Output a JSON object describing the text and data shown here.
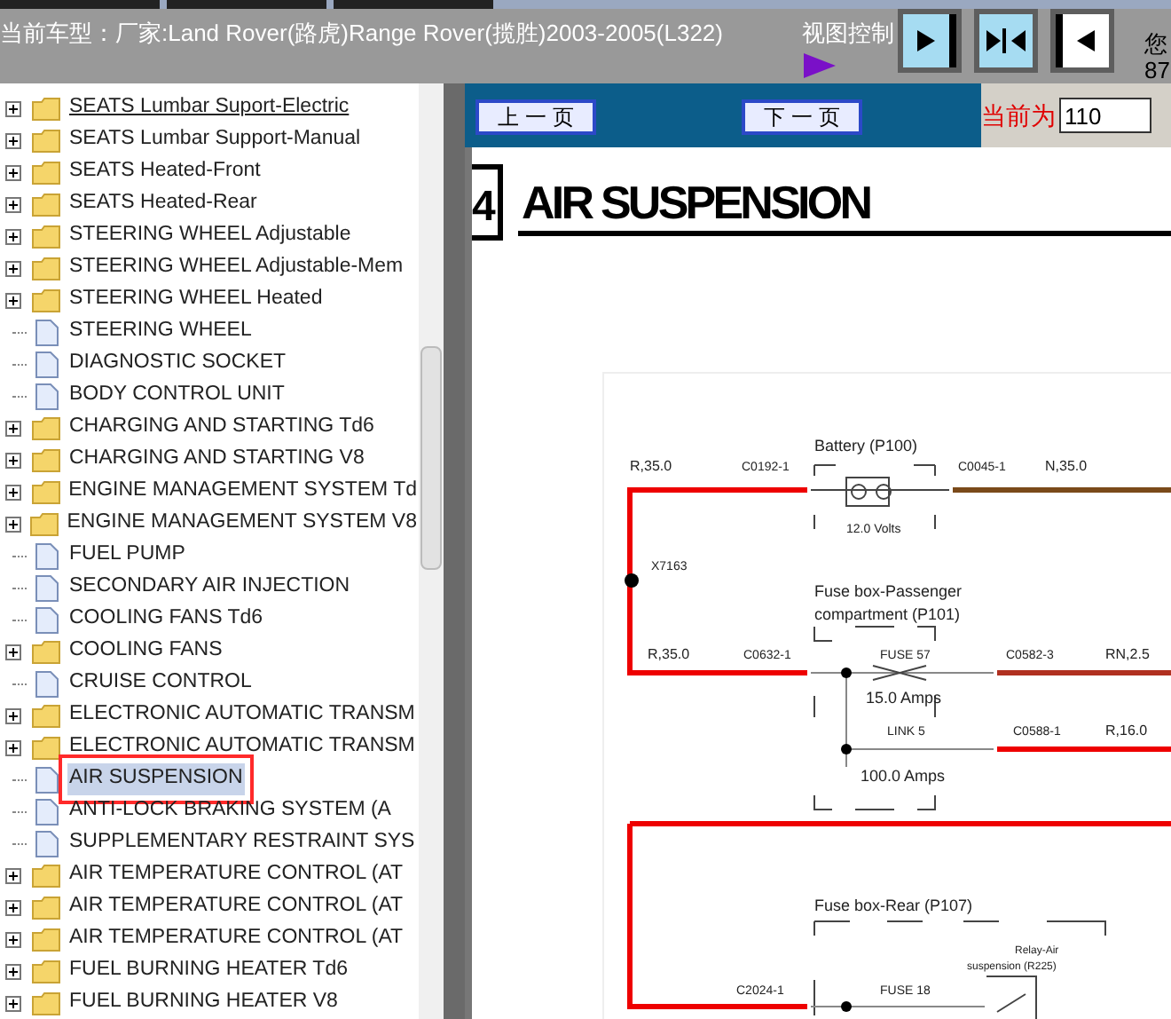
{
  "header": {
    "title": "当前车型：厂家:Land Rover(路虎)Range Rover(揽胜)2003-2005(L322)",
    "view_control_label": "视图控制",
    "edge_text_1": "您",
    "edge_text_2": "87"
  },
  "tree": {
    "items": [
      {
        "label": "SEATS Lumbar Suport-Electric",
        "kind": "folder",
        "hovered": true,
        "selected": false
      },
      {
        "label": "SEATS Lumbar Support-Manual",
        "kind": "folder",
        "hovered": false,
        "selected": false
      },
      {
        "label": "SEATS Heated-Front",
        "kind": "folder",
        "hovered": false,
        "selected": false
      },
      {
        "label": "SEATS Heated-Rear",
        "kind": "folder",
        "hovered": false,
        "selected": false
      },
      {
        "label": "STEERING WHEEL Adjustable",
        "kind": "folder",
        "hovered": false,
        "selected": false
      },
      {
        "label": "STEERING WHEEL Adjustable-Mem",
        "kind": "folder",
        "hovered": false,
        "selected": false
      },
      {
        "label": "STEERING WHEEL Heated",
        "kind": "folder",
        "hovered": false,
        "selected": false
      },
      {
        "label": "STEERING WHEEL",
        "kind": "page",
        "hovered": false,
        "selected": false
      },
      {
        "label": "DIAGNOSTIC SOCKET",
        "kind": "page",
        "hovered": false,
        "selected": false
      },
      {
        "label": "BODY CONTROL UNIT",
        "kind": "page",
        "hovered": false,
        "selected": false
      },
      {
        "label": "CHARGING AND STARTING Td6",
        "kind": "folder",
        "hovered": false,
        "selected": false
      },
      {
        "label": "CHARGING AND STARTING V8",
        "kind": "folder",
        "hovered": false,
        "selected": false
      },
      {
        "label": "ENGINE MANAGEMENT SYSTEM Td",
        "kind": "folder",
        "hovered": false,
        "selected": false
      },
      {
        "label": "ENGINE MANAGEMENT SYSTEM V8",
        "kind": "folder",
        "hovered": false,
        "selected": false
      },
      {
        "label": "FUEL PUMP",
        "kind": "page",
        "hovered": false,
        "selected": false
      },
      {
        "label": "SECONDARY AIR INJECTION",
        "kind": "page",
        "hovered": false,
        "selected": false
      },
      {
        "label": "COOLING FANS Td6",
        "kind": "page",
        "hovered": false,
        "selected": false
      },
      {
        "label": "COOLING FANS",
        "kind": "folder",
        "hovered": false,
        "selected": false
      },
      {
        "label": "CRUISE CONTROL",
        "kind": "page",
        "hovered": false,
        "selected": false
      },
      {
        "label": "ELECTRONIC AUTOMATIC TRANSM",
        "kind": "folder",
        "hovered": false,
        "selected": false
      },
      {
        "label": "ELECTRONIC AUTOMATIC TRANSM",
        "kind": "folder",
        "hovered": false,
        "selected": false
      },
      {
        "label": "AIR SUSPENSION",
        "kind": "page",
        "hovered": false,
        "selected": true
      },
      {
        "label": "ANTI-LOCK BRAKING SYSTEM (A",
        "kind": "page",
        "hovered": false,
        "selected": false
      },
      {
        "label": "SUPPLEMENTARY RESTRAINT SYS",
        "kind": "page",
        "hovered": false,
        "selected": false
      },
      {
        "label": "AIR TEMPERATURE CONTROL (AT",
        "kind": "folder",
        "hovered": false,
        "selected": false
      },
      {
        "label": "AIR TEMPERATURE CONTROL (AT",
        "kind": "folder",
        "hovered": false,
        "selected": false
      },
      {
        "label": "AIR TEMPERATURE CONTROL (AT",
        "kind": "folder",
        "hovered": false,
        "selected": false
      },
      {
        "label": "FUEL BURNING HEATER Td6",
        "kind": "folder",
        "hovered": false,
        "selected": false
      },
      {
        "label": "FUEL BURNING HEATER V8",
        "kind": "folder",
        "hovered": false,
        "selected": false
      }
    ]
  },
  "toolbar": {
    "prev_button": "上 一 页",
    "next_button": "下 一 页",
    "current_label": "当前为",
    "current_page": "110"
  },
  "document": {
    "section_number": "4",
    "title": "AIR SUSPENSION",
    "labels": [
      "R,35.0",
      "C0192-1",
      "Battery (P100)",
      "C0045-1",
      "N,35.0",
      "12.0 Volts",
      "X7163",
      "Fuse box-Passenger",
      "compartment (P101)",
      "R,35.0",
      "C0632-1",
      "FUSE 57",
      "C0582-3",
      "RN,2.5",
      "15.0 Amps",
      "LINK 5",
      "C0588-1",
      "R,16.0",
      "100.0 Amps",
      "Fuse box-Rear (P107)",
      "Relay-Air",
      "suspension (R225)",
      "C2024-1",
      "FUSE 18"
    ]
  }
}
